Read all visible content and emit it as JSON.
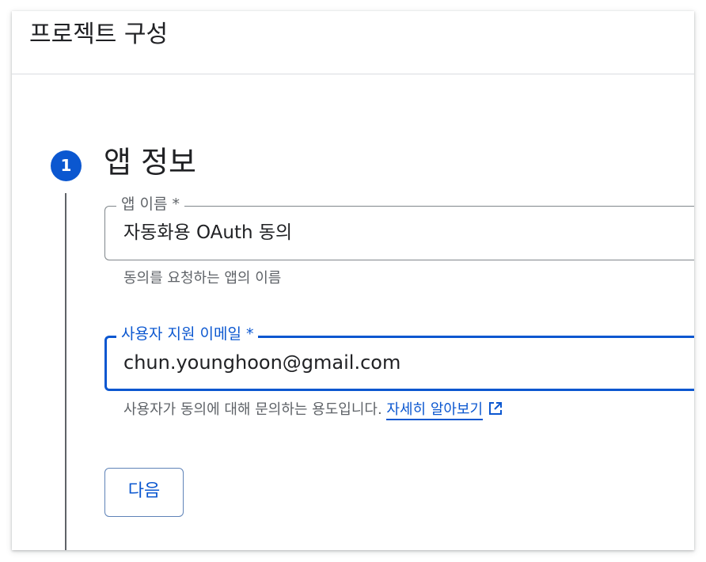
{
  "header": {
    "title": "프로젝트 구성"
  },
  "step": {
    "number": "1",
    "title": "앱 정보"
  },
  "app_name_field": {
    "label": "앱 이름 *",
    "value": "자동화용 OAuth 동의",
    "helper": "동의를 요청하는 앱의 이름"
  },
  "support_email_field": {
    "label": "사용자 지원 이메일 *",
    "value": "chun.younghoon@gmail.com",
    "helper": "사용자가 동의에 대해 문의하는 용도입니다.",
    "link_label": "자세히 알아보기",
    "link_icon": "open-in-new-icon"
  },
  "actions": {
    "next_label": "다음"
  },
  "colors": {
    "accent": "#0b57d0",
    "text_primary": "#202124",
    "text_secondary": "#5f6368",
    "border": "#80868b"
  }
}
